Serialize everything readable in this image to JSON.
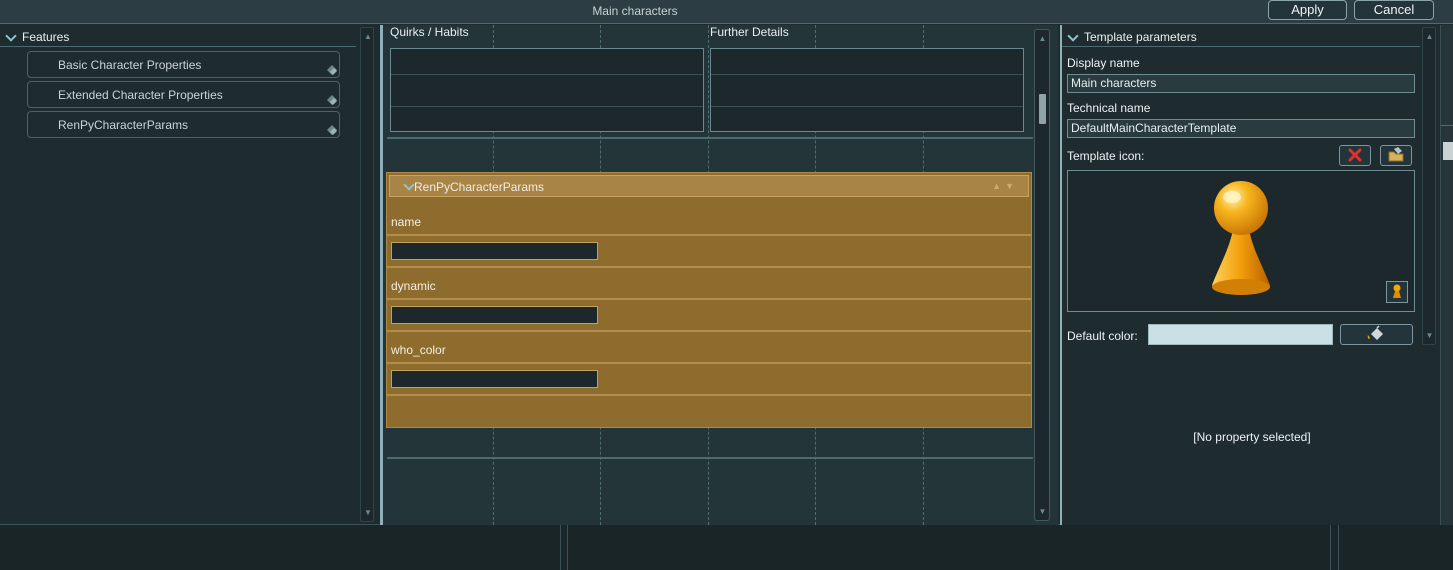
{
  "window": {
    "title": "Main characters",
    "apply_label": "Apply",
    "cancel_label": "Cancel"
  },
  "features": {
    "header": "Features",
    "items": [
      {
        "label": "Basic Character Properties"
      },
      {
        "label": "Extended Character Properties"
      },
      {
        "label": "RenPyCharacterParams"
      }
    ]
  },
  "center": {
    "col_quirks": "Quirks / Habits",
    "col_details": "Further Details",
    "params_group": {
      "title": "RenPyCharacterParams",
      "fields": [
        {
          "label": "name",
          "value": ""
        },
        {
          "label": "dynamic",
          "value": ""
        },
        {
          "label": "who_color",
          "value": ""
        }
      ]
    }
  },
  "template": {
    "header": "Template parameters",
    "display_name_label": "Display name",
    "display_name_value": "Main characters",
    "technical_name_label": "Technical name",
    "technical_name_value": "DefaultMainCharacterTemplate",
    "icon_label": "Template icon:",
    "default_color_label": "Default color:",
    "default_color_value": "#cbe0e6",
    "no_property": "[No property selected]"
  },
  "colors": {
    "accent": "#8ec3d0",
    "group_fill": "#8e6c2d",
    "delete_red": "#e0322b",
    "pawn_orange": "#f5a800"
  },
  "icons": [
    "chevron-down-icon",
    "grip-icon",
    "delete-icon",
    "folder-open-icon",
    "pawn-icon",
    "paint-bucket-icon"
  ]
}
